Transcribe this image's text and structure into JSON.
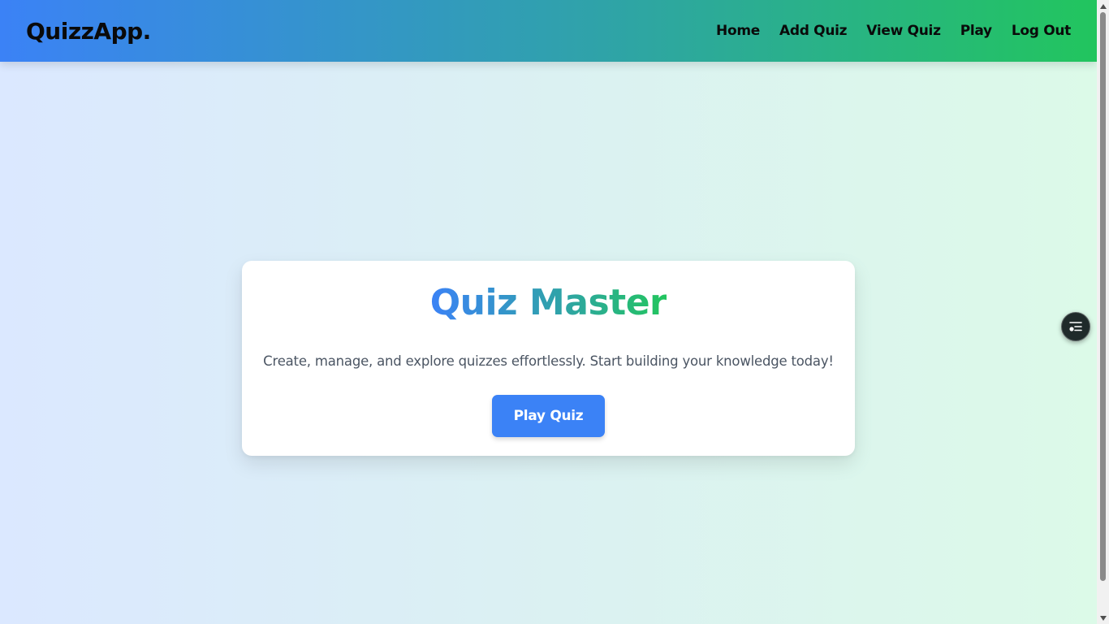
{
  "navbar": {
    "brand": "QuizzApp.",
    "links": [
      "Home",
      "Add Quiz",
      "View Quiz",
      "Play",
      "Log Out"
    ]
  },
  "hero": {
    "title": "Quiz Master",
    "subtitle": "Create, manage, and explore quizzes effortlessly. Start building your knowledge today!",
    "button_label": "Play Quiz"
  },
  "floating_button": {
    "icon": "playlist-icon"
  },
  "colors": {
    "primary": "#3b82f6",
    "accent_teal": "#2fa3a8",
    "accent_green": "#22c55e",
    "subtitle_text": "#4b5563"
  },
  "scrollbar": {
    "position": 0.0
  }
}
